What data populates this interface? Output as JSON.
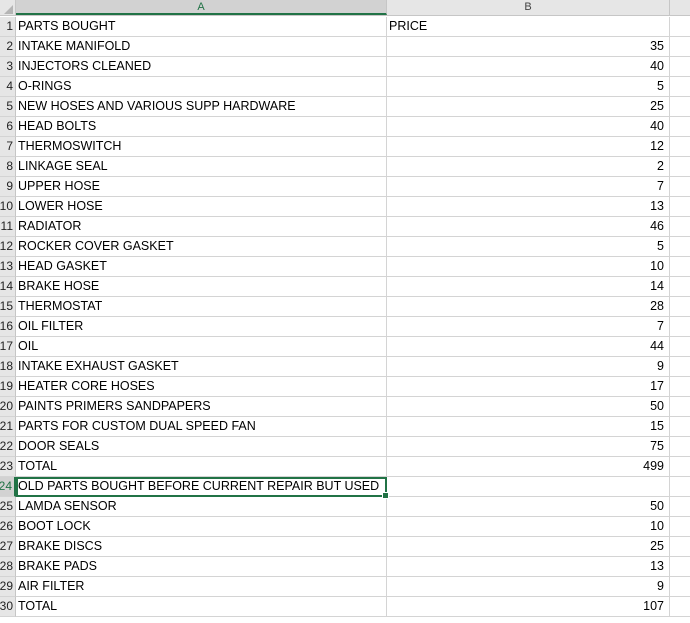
{
  "columns": {
    "a": "A",
    "b": "B"
  },
  "rows": [
    {
      "num": "1",
      "a": "PARTS BOUGHT",
      "b": "PRICE"
    },
    {
      "num": "2",
      "a": "INTAKE MANIFOLD",
      "b": "35"
    },
    {
      "num": "3",
      "a": "INJECTORS CLEANED",
      "b": "40"
    },
    {
      "num": "4",
      "a": "O-RINGS",
      "b": "5"
    },
    {
      "num": "5",
      "a": "NEW HOSES AND VARIOUS SUPP HARDWARE",
      "b": "25"
    },
    {
      "num": "6",
      "a": "HEAD BOLTS",
      "b": "40"
    },
    {
      "num": "7",
      "a": "THERMOSWITCH",
      "b": "12"
    },
    {
      "num": "8",
      "a": "LINKAGE SEAL",
      "b": "2"
    },
    {
      "num": "9",
      "a": "UPPER HOSE",
      "b": "7"
    },
    {
      "num": "10",
      "a": "LOWER HOSE",
      "b": "13"
    },
    {
      "num": "11",
      "a": "RADIATOR",
      "b": "46"
    },
    {
      "num": "12",
      "a": "ROCKER COVER GASKET",
      "b": "5"
    },
    {
      "num": "13",
      "a": "HEAD GASKET",
      "b": "10"
    },
    {
      "num": "14",
      "a": "BRAKE HOSE",
      "b": "14"
    },
    {
      "num": "15",
      "a": "THERMOSTAT",
      "b": "28"
    },
    {
      "num": "16",
      "a": "OIL FILTER",
      "b": "7"
    },
    {
      "num": "17",
      "a": "OIL",
      "b": "44"
    },
    {
      "num": "18",
      "a": "INTAKE EXHAUST GASKET",
      "b": "9"
    },
    {
      "num": "19",
      "a": "HEATER CORE HOSES",
      "b": "17"
    },
    {
      "num": "20",
      "a": "PAINTS PRIMERS SANDPAPERS",
      "b": "50"
    },
    {
      "num": "21",
      "a": "PARTS FOR CUSTOM DUAL SPEED FAN",
      "b": "15"
    },
    {
      "num": "22",
      "a": "DOOR SEALS",
      "b": "75"
    },
    {
      "num": "23",
      "a": "TOTAL",
      "b": "499"
    },
    {
      "num": "24",
      "a": "OLD PARTS BOUGHT BEFORE CURRENT REPAIR BUT USED",
      "b": ""
    },
    {
      "num": "25",
      "a": "LAMDA SENSOR",
      "b": "50"
    },
    {
      "num": "26",
      "a": "BOOT LOCK",
      "b": "10"
    },
    {
      "num": "27",
      "a": "BRAKE DISCS",
      "b": "25"
    },
    {
      "num": "28",
      "a": "BRAKE PADS",
      "b": "13"
    },
    {
      "num": "29",
      "a": "AIR FILTER",
      "b": "9"
    },
    {
      "num": "30",
      "a": "TOTAL",
      "b": "107"
    }
  ],
  "selected_row": "24",
  "accent_color": "#217346"
}
